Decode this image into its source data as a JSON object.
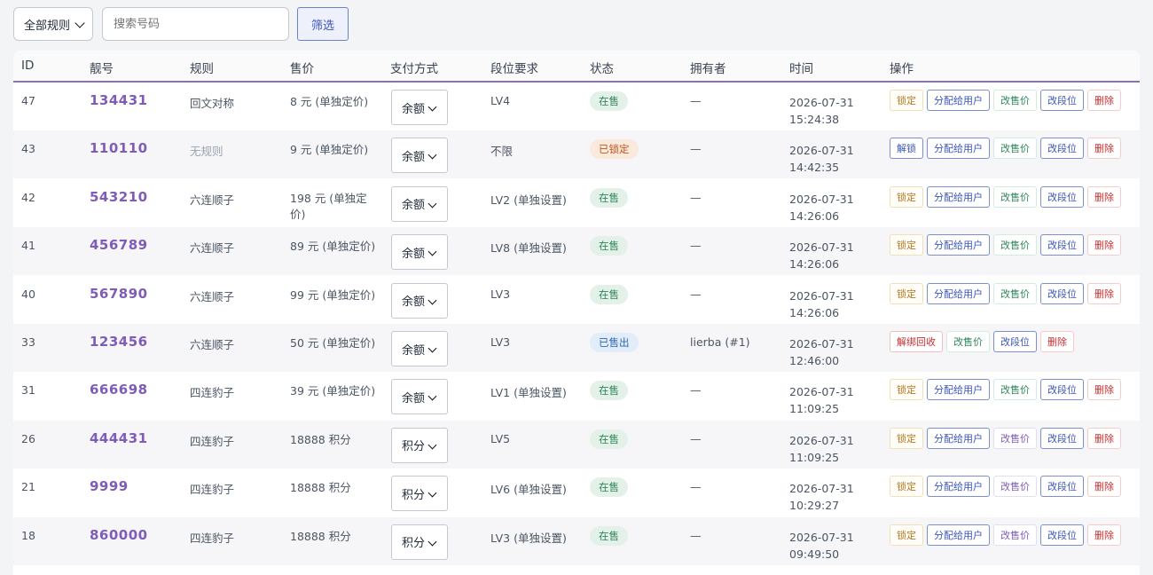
{
  "toolbar": {
    "rule_select_value": "全部规则",
    "search_placeholder": "搜索号码",
    "filter_label": "筛选"
  },
  "table": {
    "headers": [
      "ID",
      "靓号",
      "规则",
      "售价",
      "支付方式",
      "段位要求",
      "状态",
      "拥有者",
      "时间",
      "操作"
    ],
    "rows": [
      {
        "id": "47",
        "number": "134431",
        "rule": "回文对称",
        "price": "8 元 (单独定价)",
        "pay": "余额",
        "level": "LV4",
        "status": "在售",
        "owner": "—",
        "date": "2026-07-31",
        "clock": "15:24:38",
        "actions": [
          "锁定",
          "分配给用户",
          "改售价",
          "改段位",
          "删除"
        ]
      },
      {
        "id": "43",
        "number": "110110",
        "rule": "无规则",
        "price": "9 元 (单独定价)",
        "pay": "余额",
        "level": "不限",
        "status": "已锁定",
        "owner": "—",
        "date": "2026-07-31",
        "clock": "14:42:35",
        "actions": [
          "解锁",
          "分配给用户",
          "改售价",
          "改段位",
          "删除"
        ]
      },
      {
        "id": "42",
        "number": "543210",
        "rule": "六连顺子",
        "price": "198 元 (单独定价)",
        "pay": "余额",
        "level": "LV2 (单独设置)",
        "status": "在售",
        "owner": "—",
        "date": "2026-07-31",
        "clock": "14:26:06",
        "actions": [
          "锁定",
          "分配给用户",
          "改售价",
          "改段位",
          "删除"
        ]
      },
      {
        "id": "41",
        "number": "456789",
        "rule": "六连顺子",
        "price": "89 元 (单独定价)",
        "pay": "余额",
        "level": "LV8 (单独设置)",
        "status": "在售",
        "owner": "—",
        "date": "2026-07-31",
        "clock": "14:26:06",
        "actions": [
          "锁定",
          "分配给用户",
          "改售价",
          "改段位",
          "删除"
        ]
      },
      {
        "id": "40",
        "number": "567890",
        "rule": "六连顺子",
        "price": "99 元 (单独定价)",
        "pay": "余额",
        "level": "LV3",
        "status": "在售",
        "owner": "—",
        "date": "2026-07-31",
        "clock": "14:26:06",
        "actions": [
          "锁定",
          "分配给用户",
          "改售价",
          "改段位",
          "删除"
        ]
      },
      {
        "id": "33",
        "number": "123456",
        "rule": "六连顺子",
        "price": "50 元 (单独定价)",
        "pay": "余额",
        "level": "LV3",
        "status": "已售出",
        "owner": "lierba (#1)",
        "date": "2026-07-31",
        "clock": "12:46:00",
        "actions": [
          "解绑回收",
          "改售价",
          "改段位",
          "删除"
        ]
      },
      {
        "id": "31",
        "number": "666698",
        "rule": "四连豹子",
        "price": "39 元 (单独定价)",
        "pay": "余额",
        "level": "LV1 (单独设置)",
        "status": "在售",
        "owner": "—",
        "date": "2026-07-31",
        "clock": "11:09:25",
        "actions": [
          "锁定",
          "分配给用户",
          "改售价",
          "改段位",
          "删除"
        ]
      },
      {
        "id": "26",
        "number": "444431",
        "rule": "四连豹子",
        "price": "18888 积分",
        "pay": "积分",
        "level": "LV5",
        "status": "在售",
        "owner": "—",
        "date": "2026-07-31",
        "clock": "11:09:25",
        "actions": [
          "锁定",
          "分配给用户",
          "改售价",
          "改段位",
          "删除"
        ]
      },
      {
        "id": "21",
        "number": "9999",
        "rule": "四连豹子",
        "price": "18888 积分",
        "pay": "积分",
        "level": "LV6 (单独设置)",
        "status": "在售",
        "owner": "—",
        "date": "2026-07-31",
        "clock": "10:29:27",
        "actions": [
          "锁定",
          "分配给用户",
          "改售价",
          "改段位",
          "删除"
        ]
      },
      {
        "id": "18",
        "number": "860000",
        "rule": "四连豹子",
        "price": "18888 积分",
        "pay": "积分",
        "level": "LV3 (单独设置)",
        "status": "在售",
        "owner": "—",
        "date": "2026-07-31",
        "clock": "09:49:50",
        "actions": [
          "锁定",
          "分配给用户",
          "改售价",
          "改段位",
          "删除"
        ]
      }
    ]
  },
  "colors": {
    "accent_purple": "#7e5cb8",
    "status_sale": "#2f855a",
    "status_locked": "#c05621",
    "status_sold": "#2b6cb0"
  }
}
